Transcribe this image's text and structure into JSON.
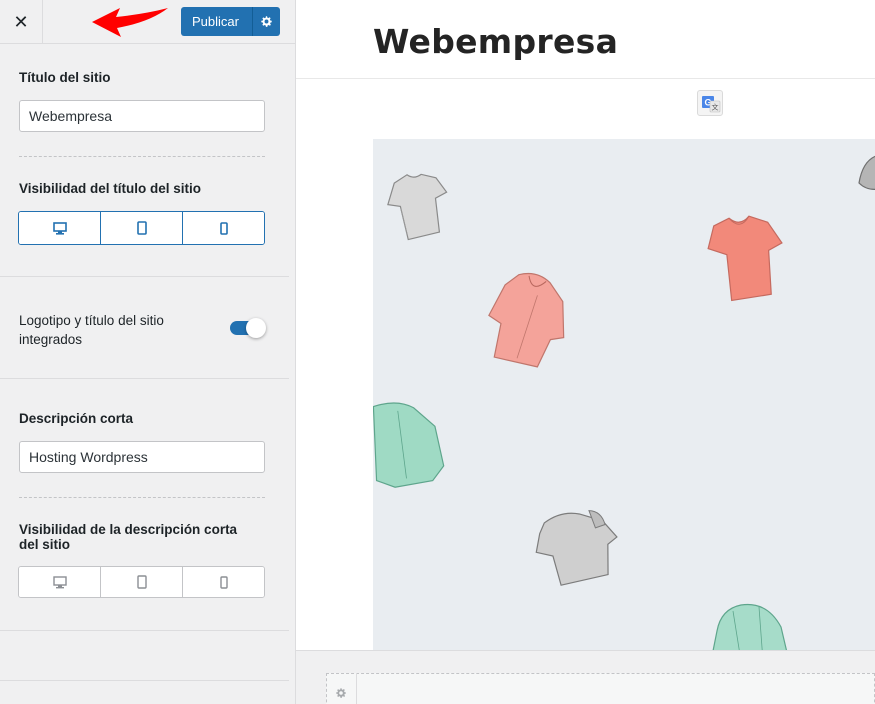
{
  "topbar": {
    "close_glyph": "✕",
    "close_icon": "close-icon",
    "publish_label": "Publicar",
    "publish_gear_icon": "gear-icon",
    "annotation_arrow_color": "#ff0000"
  },
  "sidebar": {
    "site_title_label": "Título del sitio",
    "site_title_value": "Webempresa",
    "title_visibility_label": "Visibilidad del título del sitio",
    "title_visibility_devices": [
      "desktop-icon",
      "tablet-icon",
      "mobile-icon"
    ],
    "integrated_toggle_label": "Logotipo y título del sitio integrados",
    "integrated_toggle_on": true,
    "short_desc_label": "Descripción corta",
    "short_desc_value": "Hosting Wordpress",
    "desc_visibility_label": "Visibilidad de la descripción corta del sitio",
    "desc_visibility_devices": [
      "desktop-icon",
      "tablet-icon",
      "mobile-icon"
    ]
  },
  "preview": {
    "site_title": "Webempresa",
    "translate_icon": "google-translate-icon",
    "hero_image": "hero-clothing-illustration",
    "footer_gear_icon": "gear-icon"
  },
  "colors": {
    "accent": "#2271b1",
    "sidebar_bg": "#f0f0f1",
    "hero_bg": "#e9edf1"
  }
}
